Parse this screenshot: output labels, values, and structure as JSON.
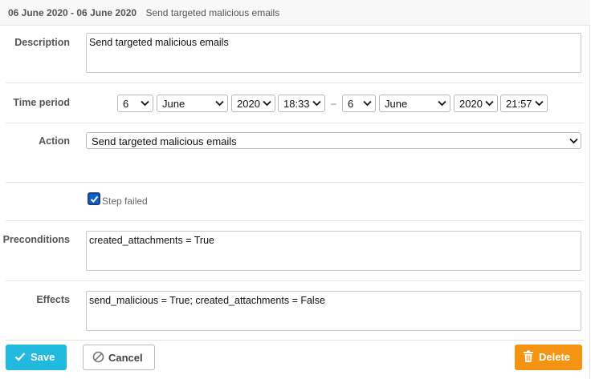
{
  "header": {
    "date_range": "06 June 2020 - 06 June 2020",
    "event_name": "Send targeted malicious emails"
  },
  "form": {
    "description": {
      "label": "Description",
      "value": "Send targeted malicious emails"
    },
    "time_period": {
      "label": "Time period",
      "start": {
        "day": "6",
        "month": "June",
        "year": "2020",
        "time": "18:33"
      },
      "separator": "–",
      "end": {
        "day": "6",
        "month": "June",
        "year": "2020",
        "time": "21:57"
      }
    },
    "action": {
      "label": "Action",
      "value": "Send targeted malicious emails"
    },
    "step_failed": {
      "label": "Step failed",
      "checked": true
    },
    "preconditions": {
      "label": "Preconditions",
      "value": "created_attachments = True"
    },
    "effects": {
      "label": "Effects",
      "value": "send_malicious = True; created_attachments = False"
    }
  },
  "footer": {
    "save_label": "Save",
    "cancel_label": "Cancel",
    "delete_label": "Delete"
  },
  "icons": {
    "save": "check-icon",
    "cancel": "ban-icon",
    "delete": "trash-icon",
    "dropdown": "chevron-down-icon"
  },
  "colors": {
    "save": "#21b9dd",
    "delete": "#f49412",
    "checkbox": "#0a60d6"
  }
}
